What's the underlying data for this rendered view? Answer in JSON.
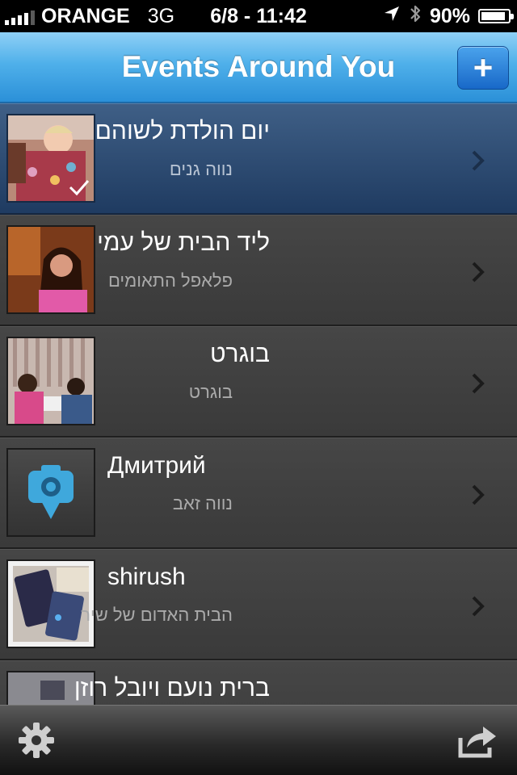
{
  "status_bar": {
    "carrier": "ORANGE",
    "network": "3G",
    "time": "6/8 - 11:42",
    "battery": "90%",
    "battery_level": 0.9
  },
  "nav": {
    "title": "Events Around You",
    "add_label": "+"
  },
  "events": [
    {
      "title": "יום הולדת לשוהם",
      "subtitle": "נווה גנים",
      "selected": true
    },
    {
      "title": "ליד הבית של עמי",
      "subtitle": "פלאפל התאומים",
      "selected": false
    },
    {
      "title": "בוגרט",
      "subtitle": "בוגרט",
      "selected": false
    },
    {
      "title": "Дмитрий",
      "subtitle": "נווה זאב",
      "selected": false
    },
    {
      "title": "shirush",
      "subtitle": "הבית האדום של שיר",
      "selected": false
    },
    {
      "title": "ברית נועם ויובל רוזן",
      "subtitle": "",
      "selected": false
    }
  ],
  "colors": {
    "nav_blue": "#2b90d8",
    "selected_row": "#1f3b61",
    "accent": "#3fa8dc"
  },
  "icons": {
    "settings": "gear-icon",
    "share": "share-icon",
    "chevron": "chevron-right-icon"
  }
}
